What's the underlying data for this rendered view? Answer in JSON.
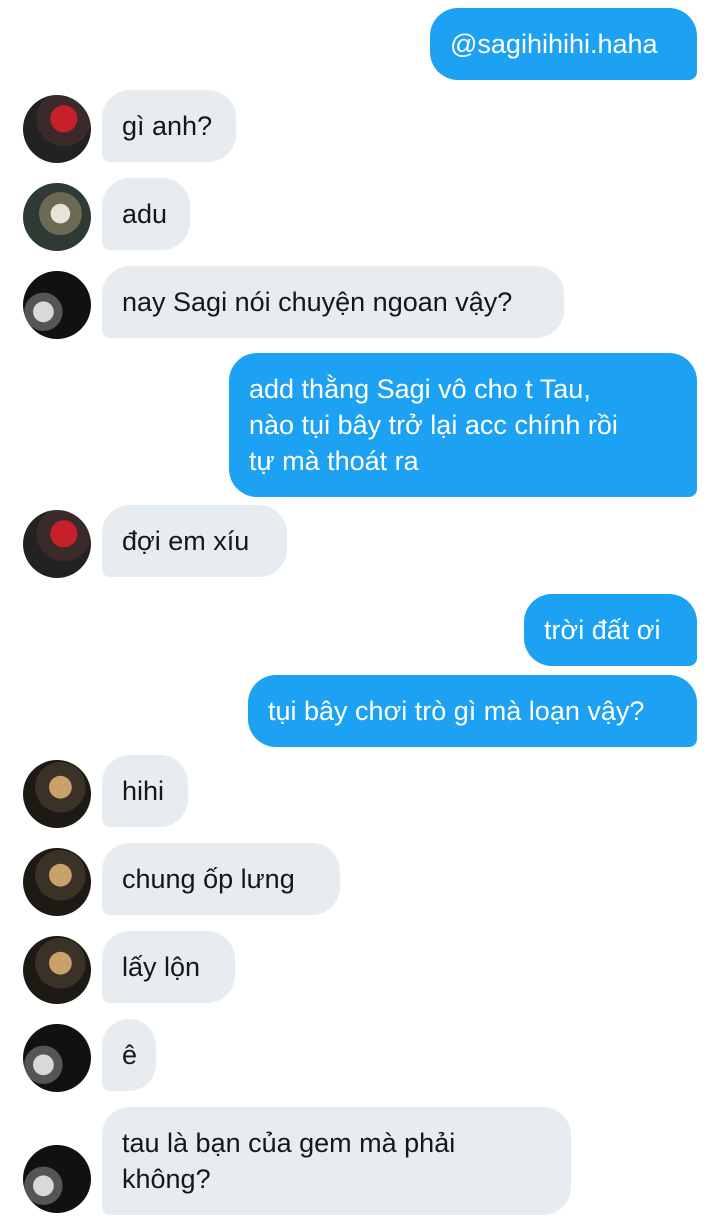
{
  "messages": [
    {
      "side": "out",
      "text": "@sagihihihi.haha"
    },
    {
      "side": "in",
      "avatar": "red-hat-avatar",
      "text": "gì anh?"
    },
    {
      "side": "in",
      "avatar": "tree-avatar",
      "text": "adu"
    },
    {
      "side": "in",
      "avatar": "cat-avatar",
      "text": "nay Sagi nói chuyện ngoan vậy?"
    },
    {
      "side": "out",
      "lines": [
        "add thằng Sagi vô cho t Tau,",
        "nào tụi bây trở lại acc chính rồi",
        "tự mà thoát ra"
      ]
    },
    {
      "side": "in",
      "avatar": "red-hat-avatar",
      "text": "đợi em xíu"
    },
    {
      "side": "out",
      "text": "trời đất ơi"
    },
    {
      "side": "out",
      "text": "tụi bây chơi trò gì mà loạn vậy?"
    },
    {
      "side": "in",
      "avatar": "gold-avatar",
      "text": "hihi"
    },
    {
      "side": "in",
      "avatar": "gold-avatar",
      "text": "chung ốp lưng"
    },
    {
      "side": "in",
      "avatar": "gold-avatar",
      "text": "lấy lộn"
    },
    {
      "side": "in",
      "avatar": "cat-avatar",
      "text": "ê"
    },
    {
      "side": "in",
      "avatar": "cat-avatar",
      "lines": [
        "tau là bạn của gem mà phải",
        "không?"
      ]
    }
  ]
}
